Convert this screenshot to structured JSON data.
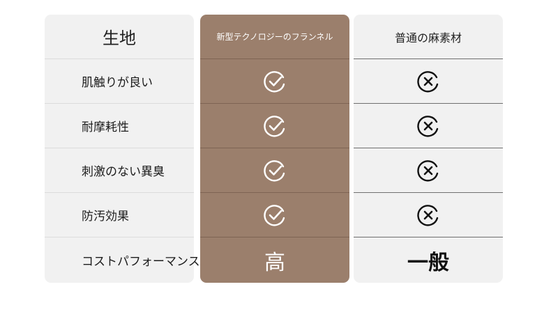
{
  "table": {
    "features_header": "生地",
    "new_header": "新型テクノロジーのフランネル",
    "normal_header": "普通の麻素材",
    "rows": [
      {
        "label": "肌触りが良い",
        "new_icon": "check-circle-icon",
        "normal_icon": "x-circle-icon"
      },
      {
        "label": "耐摩耗性",
        "new_icon": "check-circle-icon",
        "normal_icon": "x-circle-icon"
      },
      {
        "label": "刺激のない異臭",
        "new_icon": "check-circle-icon",
        "normal_icon": "x-circle-icon"
      },
      {
        "label": "防汚効果",
        "new_icon": "check-circle-icon",
        "normal_icon": "x-circle-icon"
      }
    ],
    "cost_row": {
      "label": "コストパフォーマンス",
      "new_value": "高",
      "normal_value": "一般"
    }
  },
  "colors": {
    "highlight_column": "#9b7f6c",
    "plain_column": "#f1f1f1"
  }
}
